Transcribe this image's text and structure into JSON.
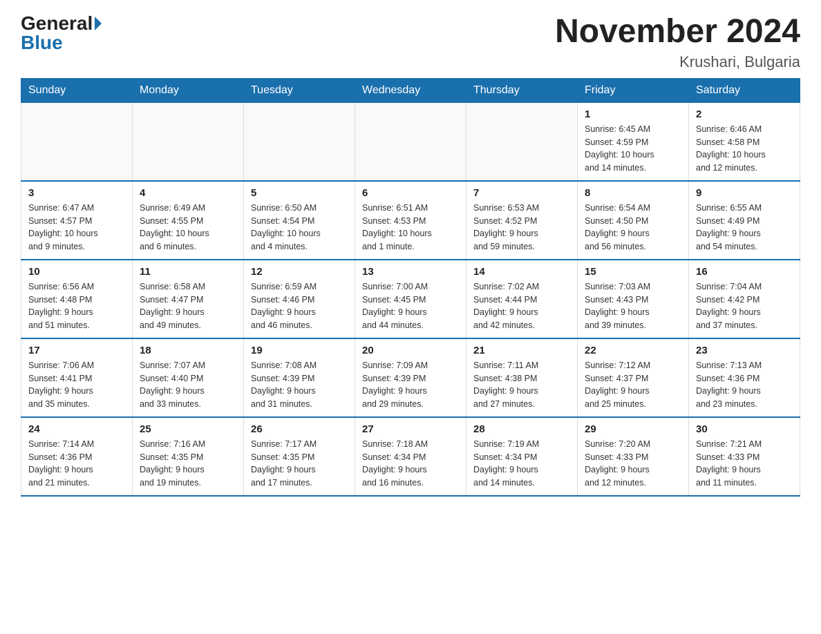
{
  "header": {
    "logo_general": "General",
    "logo_blue": "Blue",
    "title": "November 2024",
    "subtitle": "Krushari, Bulgaria"
  },
  "days_of_week": [
    "Sunday",
    "Monday",
    "Tuesday",
    "Wednesday",
    "Thursday",
    "Friday",
    "Saturday"
  ],
  "weeks": [
    [
      {
        "day": "",
        "info": ""
      },
      {
        "day": "",
        "info": ""
      },
      {
        "day": "",
        "info": ""
      },
      {
        "day": "",
        "info": ""
      },
      {
        "day": "",
        "info": ""
      },
      {
        "day": "1",
        "info": "Sunrise: 6:45 AM\nSunset: 4:59 PM\nDaylight: 10 hours\nand 14 minutes."
      },
      {
        "day": "2",
        "info": "Sunrise: 6:46 AM\nSunset: 4:58 PM\nDaylight: 10 hours\nand 12 minutes."
      }
    ],
    [
      {
        "day": "3",
        "info": "Sunrise: 6:47 AM\nSunset: 4:57 PM\nDaylight: 10 hours\nand 9 minutes."
      },
      {
        "day": "4",
        "info": "Sunrise: 6:49 AM\nSunset: 4:55 PM\nDaylight: 10 hours\nand 6 minutes."
      },
      {
        "day": "5",
        "info": "Sunrise: 6:50 AM\nSunset: 4:54 PM\nDaylight: 10 hours\nand 4 minutes."
      },
      {
        "day": "6",
        "info": "Sunrise: 6:51 AM\nSunset: 4:53 PM\nDaylight: 10 hours\nand 1 minute."
      },
      {
        "day": "7",
        "info": "Sunrise: 6:53 AM\nSunset: 4:52 PM\nDaylight: 9 hours\nand 59 minutes."
      },
      {
        "day": "8",
        "info": "Sunrise: 6:54 AM\nSunset: 4:50 PM\nDaylight: 9 hours\nand 56 minutes."
      },
      {
        "day": "9",
        "info": "Sunrise: 6:55 AM\nSunset: 4:49 PM\nDaylight: 9 hours\nand 54 minutes."
      }
    ],
    [
      {
        "day": "10",
        "info": "Sunrise: 6:56 AM\nSunset: 4:48 PM\nDaylight: 9 hours\nand 51 minutes."
      },
      {
        "day": "11",
        "info": "Sunrise: 6:58 AM\nSunset: 4:47 PM\nDaylight: 9 hours\nand 49 minutes."
      },
      {
        "day": "12",
        "info": "Sunrise: 6:59 AM\nSunset: 4:46 PM\nDaylight: 9 hours\nand 46 minutes."
      },
      {
        "day": "13",
        "info": "Sunrise: 7:00 AM\nSunset: 4:45 PM\nDaylight: 9 hours\nand 44 minutes."
      },
      {
        "day": "14",
        "info": "Sunrise: 7:02 AM\nSunset: 4:44 PM\nDaylight: 9 hours\nand 42 minutes."
      },
      {
        "day": "15",
        "info": "Sunrise: 7:03 AM\nSunset: 4:43 PM\nDaylight: 9 hours\nand 39 minutes."
      },
      {
        "day": "16",
        "info": "Sunrise: 7:04 AM\nSunset: 4:42 PM\nDaylight: 9 hours\nand 37 minutes."
      }
    ],
    [
      {
        "day": "17",
        "info": "Sunrise: 7:06 AM\nSunset: 4:41 PM\nDaylight: 9 hours\nand 35 minutes."
      },
      {
        "day": "18",
        "info": "Sunrise: 7:07 AM\nSunset: 4:40 PM\nDaylight: 9 hours\nand 33 minutes."
      },
      {
        "day": "19",
        "info": "Sunrise: 7:08 AM\nSunset: 4:39 PM\nDaylight: 9 hours\nand 31 minutes."
      },
      {
        "day": "20",
        "info": "Sunrise: 7:09 AM\nSunset: 4:39 PM\nDaylight: 9 hours\nand 29 minutes."
      },
      {
        "day": "21",
        "info": "Sunrise: 7:11 AM\nSunset: 4:38 PM\nDaylight: 9 hours\nand 27 minutes."
      },
      {
        "day": "22",
        "info": "Sunrise: 7:12 AM\nSunset: 4:37 PM\nDaylight: 9 hours\nand 25 minutes."
      },
      {
        "day": "23",
        "info": "Sunrise: 7:13 AM\nSunset: 4:36 PM\nDaylight: 9 hours\nand 23 minutes."
      }
    ],
    [
      {
        "day": "24",
        "info": "Sunrise: 7:14 AM\nSunset: 4:36 PM\nDaylight: 9 hours\nand 21 minutes."
      },
      {
        "day": "25",
        "info": "Sunrise: 7:16 AM\nSunset: 4:35 PM\nDaylight: 9 hours\nand 19 minutes."
      },
      {
        "day": "26",
        "info": "Sunrise: 7:17 AM\nSunset: 4:35 PM\nDaylight: 9 hours\nand 17 minutes."
      },
      {
        "day": "27",
        "info": "Sunrise: 7:18 AM\nSunset: 4:34 PM\nDaylight: 9 hours\nand 16 minutes."
      },
      {
        "day": "28",
        "info": "Sunrise: 7:19 AM\nSunset: 4:34 PM\nDaylight: 9 hours\nand 14 minutes."
      },
      {
        "day": "29",
        "info": "Sunrise: 7:20 AM\nSunset: 4:33 PM\nDaylight: 9 hours\nand 12 minutes."
      },
      {
        "day": "30",
        "info": "Sunrise: 7:21 AM\nSunset: 4:33 PM\nDaylight: 9 hours\nand 11 minutes."
      }
    ]
  ]
}
